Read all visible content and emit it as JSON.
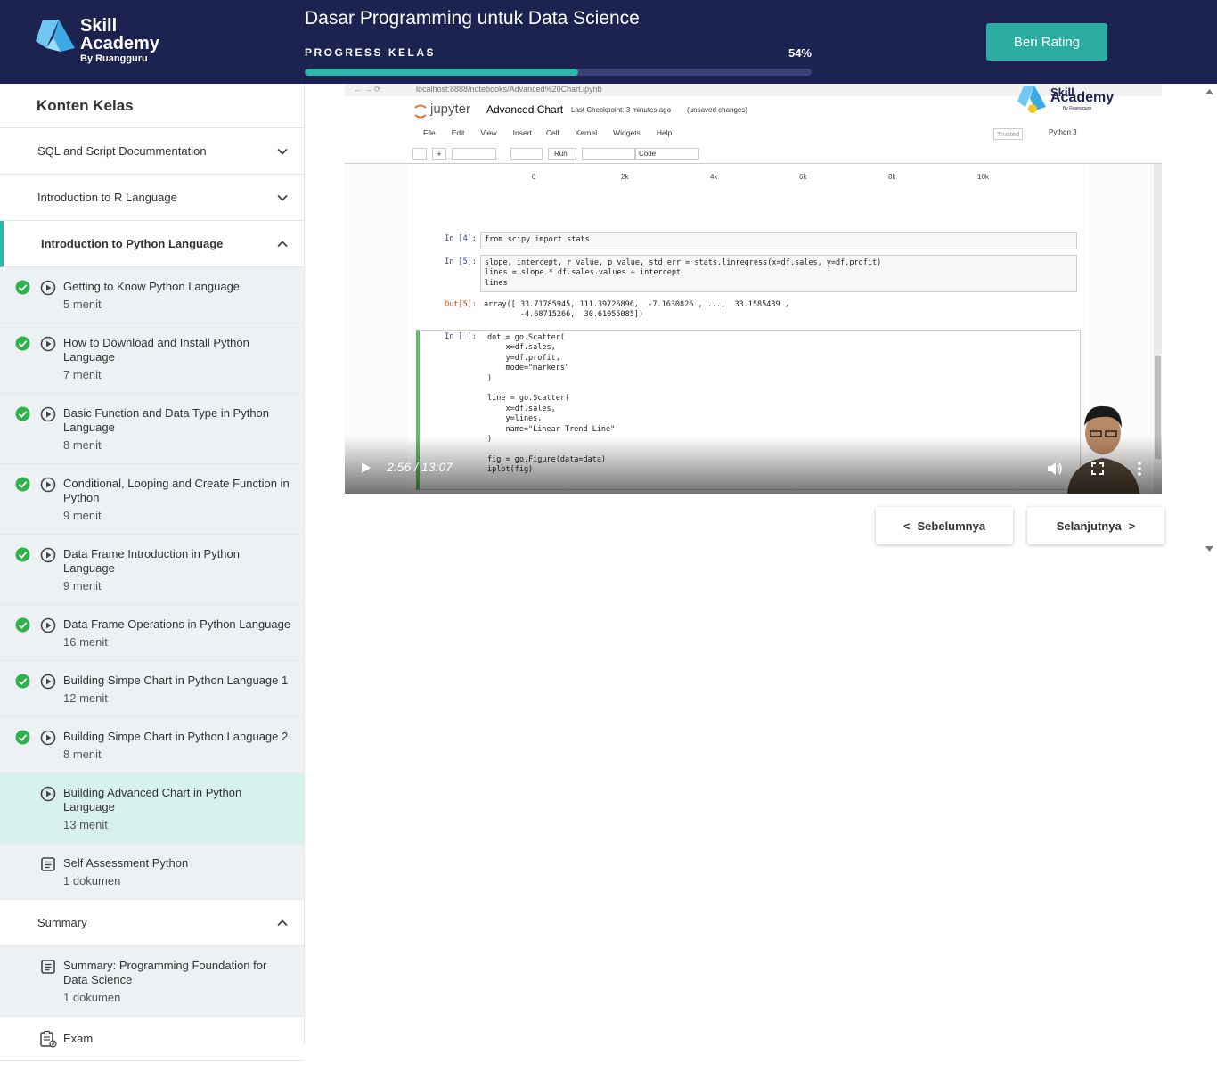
{
  "header": {
    "logo_line1": "Skill",
    "logo_line2": "Academy",
    "logo_line3": "By Ruangguru",
    "course_title": "Dasar Programming untuk Data Science",
    "progress_label": "PROGRESS KELAS",
    "progress_text": "54%",
    "progress_value": 0.54,
    "rating_button": "Beri Rating"
  },
  "colors": {
    "header_bg": "#1c2350",
    "accent": "#2eb6aa",
    "current_lesson_bg": "#d6f1ee",
    "done_check": "#2db34a"
  },
  "sidebar": {
    "title": "Konten Kelas",
    "sections": [
      {
        "label": "SQL and Script Docummentation",
        "expanded": false
      },
      {
        "label": "Introduction to R Language",
        "expanded": false
      },
      {
        "label": "Introduction to Python Language",
        "expanded": true
      },
      {
        "label": "Summary",
        "expanded": true
      }
    ],
    "python_lessons": [
      {
        "name": "Getting to Know Python Language",
        "duration": "5 menit",
        "done": true,
        "icon": "play-circle-icon"
      },
      {
        "name": "How to Download and Install Python Language",
        "duration": "7 menit",
        "done": true,
        "icon": "play-circle-icon"
      },
      {
        "name": "Basic Function and Data Type in Python Language",
        "duration": "8 menit",
        "done": true,
        "icon": "play-circle-icon"
      },
      {
        "name": "Conditional, Looping and Create Function in Python",
        "duration": "9 menit",
        "done": true,
        "icon": "play-circle-icon"
      },
      {
        "name": "Data Frame Introduction in Python Language",
        "duration": "9 menit",
        "done": true,
        "icon": "play-circle-icon"
      },
      {
        "name": "Data Frame Operations in Python Language",
        "duration": "16 menit",
        "done": true,
        "icon": "play-circle-icon"
      },
      {
        "name": "Building Simpe Chart in Python Language 1",
        "duration": "12 menit",
        "done": true,
        "icon": "play-circle-icon"
      },
      {
        "name": "Building Simpe Chart in Python Language 2",
        "duration": "8 menit",
        "done": true,
        "icon": "play-circle-icon"
      },
      {
        "name": "Building Advanced Chart in Python Language",
        "duration": "13 menit",
        "done": false,
        "current": true,
        "icon": "play-circle-icon"
      },
      {
        "name": "Self Assessment Python",
        "duration": "1 dokumen",
        "done": false,
        "icon": "document-icon"
      }
    ],
    "summary_items": [
      {
        "name": "Summary: Programming Foundation for Data Science",
        "duration": "1 dokumen",
        "icon": "document-icon"
      }
    ],
    "exam_label": "Exam"
  },
  "video": {
    "url_text": "localhost:8888/notebooks/Advanced%20Chart.ipynb",
    "jupyter_brand": "jupyter",
    "notebook_title": "Advanced Chart",
    "checkpoint": "Last Checkpoint: 3 minutes ago",
    "unsaved": "(unsaved changes)",
    "menu": [
      "File",
      "Edit",
      "View",
      "Insert",
      "Cell",
      "Kernel",
      "Widgets",
      "Help"
    ],
    "trusted": "Trusted",
    "kernel": "Python 3",
    "run_label": "Run",
    "cell_type": "Code",
    "watermark_line1": "Skill",
    "watermark_line2": "Academy",
    "watermark_line3": "By Ruangguru",
    "axis_ticks": [
      "0",
      "2k",
      "4k",
      "6k",
      "8k",
      "10k"
    ],
    "cells": [
      {
        "prompt": "In [4]:",
        "code": "from scipy import stats"
      },
      {
        "prompt": "In [5]:",
        "code": "slope, intercept, r_value, p_value, std_err = stats.linregress(x=df.sales, y=df.profit)\nlines = slope * df.sales.values + intercept\nlines"
      },
      {
        "prompt": "Out[5]:",
        "code": "array([ 33.71785945, 111.39726896,  -7.1630826 , ...,  33.1585439 ,\n        -4.68715266,  30.61055085])"
      },
      {
        "prompt": "In [ ]:",
        "code": "dot = go.Scatter(\n    x=df.sales,\n    y=df.profit,\n    mode=\"markers\"\n)\n\nline = go.Scatter(\n    x=df.sales,\n    y=lines,\n    name=\"Linear Trend Line\"\n)\n\nfig = go.Figure(data=data)\niplot(fig)"
      }
    ],
    "time_display": "2:56 / 13:07"
  },
  "navigation": {
    "prev": "Sebelumnya",
    "next": "Selanjutnya"
  }
}
